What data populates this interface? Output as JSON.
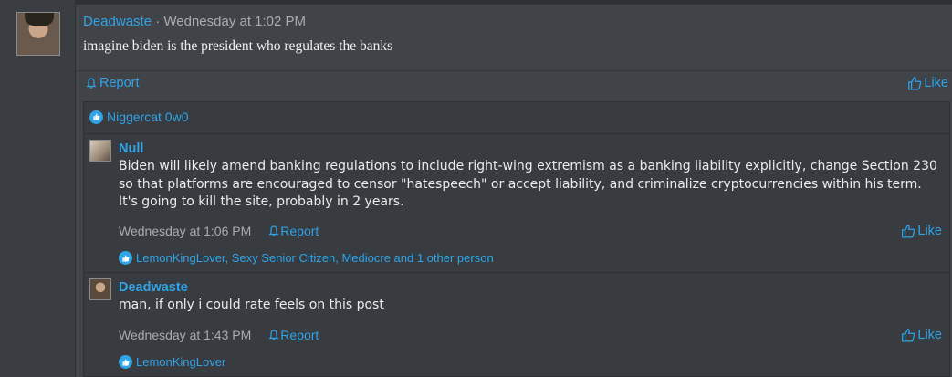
{
  "post": {
    "author": "Deadwaste",
    "separator": "·",
    "time": "Wednesday at 1:02 PM",
    "body": "imagine biden is the president who regulates the banks",
    "report_label": "Report",
    "like_label": "Like",
    "likers": "Niggercat 0w0"
  },
  "replies": [
    {
      "author": "Null",
      "text": "Biden will likely amend banking regulations to include right-wing extremism as a banking liability explicitly, change Section 230 so that platforms are encouraged to censor \"hatespeech\" or accept liability, and criminalize cryptocurrencies within his term. It's going to kill the site, probably in 2 years.",
      "time": "Wednesday at 1:06 PM",
      "report_label": "Report",
      "like_label": "Like",
      "likers": "LemonKingLover, Sexy Senior Citizen, Mediocre and 1 other person"
    },
    {
      "author": "Deadwaste",
      "text": "man, if only i could rate feels on this post",
      "time": "Wednesday at 1:43 PM",
      "report_label": "Report",
      "like_label": "Like",
      "likers": "LemonKingLover"
    }
  ],
  "colors": {
    "link": "#2fa4e7",
    "background": "#3b3e42",
    "text": "#e6e6e6"
  }
}
